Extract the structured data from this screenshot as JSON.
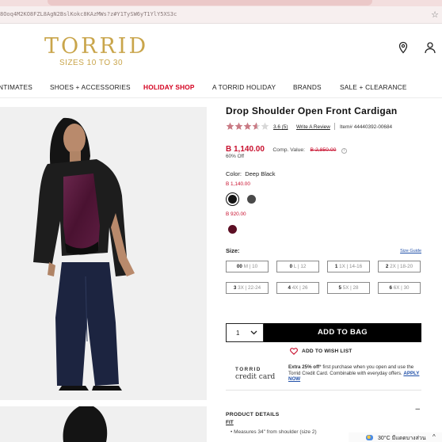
{
  "browser": {
    "url": "8Ooq4M2KO8FZL8AgN2BslKokc8KAzMWs?z#Y1TySW6yT1YlY5XS3c",
    "star_icon": "bookmark-star-icon"
  },
  "header": {
    "logo_word": "TORRID",
    "logo_sub": "SIZES 10 TO 30",
    "icons": [
      "store-locator-pin-icon",
      "account-user-icon"
    ]
  },
  "nav": {
    "items": [
      {
        "label": "NTIMATES"
      },
      {
        "label": "SHOES + ACCESSORIES"
      },
      {
        "label": "HOLIDAY SHOP"
      },
      {
        "label": "A TORRID HOLIDAY"
      },
      {
        "label": "BRANDS"
      },
      {
        "label": "SALE + CLEARANCE"
      }
    ],
    "highlight_color": "#d4001f"
  },
  "product": {
    "title": "Drop Shoulder Open Front Cardigan",
    "rating_value": 3.6,
    "rating_text": "3.6",
    "review_count": "(5)",
    "write_review": "Write A Review",
    "item_number": "Item# 44440392-00684",
    "price": "B 1,140.00",
    "comp_label": "Comp. Value:",
    "comp_value": "B 2,850.00",
    "percent_off": "60% Off",
    "color_label": "Color:",
    "color_value": "Deep Black",
    "price_group_1": "B 1,140.00",
    "price_group_2": "B 920.00",
    "swatches": [
      {
        "name": "Deep Black",
        "color": "#151515",
        "selected": true
      },
      {
        "name": "Charcoal",
        "color": "#4a4a4a",
        "selected": false
      },
      {
        "name": "Burgundy",
        "color": "#5c0f24",
        "selected": false
      }
    ],
    "size_label": "Size:",
    "size_guide": "Size Guide",
    "sizes": [
      {
        "size": "00",
        "alt": "M | 10"
      },
      {
        "size": "0",
        "alt": "L | 12"
      },
      {
        "size": "1",
        "alt": "1X | 14-16"
      },
      {
        "size": "2",
        "alt": "2X | 18-20"
      },
      {
        "size": "3",
        "alt": "3X | 22-24"
      },
      {
        "size": "4",
        "alt": "4X | 26"
      },
      {
        "size": "5",
        "alt": "5X | 28"
      },
      {
        "size": "6",
        "alt": "6X | 30"
      }
    ],
    "quantity": "1",
    "add_to_bag": "ADD TO BAG",
    "wishlist": "ADD TO WISH LIST",
    "credit_card_top": "TORRID",
    "credit_card_bottom": "credit card",
    "credit_offer": "Extra 25% off",
    "credit_offer_rest": "first purchase when you open and use the Torrid Credit Card. Combinable with everyday offers.",
    "apply_now": "APPLY NOW",
    "details_header": "PRODUCT DETAILS",
    "fit_label": "FIT",
    "fit_bullet": "•  Measures 34\" from shoulder (size 2)"
  },
  "taskbar": {
    "weather": "30°C  มีแดดบางส่วน",
    "chevron": "^"
  },
  "colors": {
    "brand_gold": "#c9a54b",
    "sale_red": "#c8102e",
    "link_blue": "#1f4fa8",
    "button_black": "#000000"
  }
}
